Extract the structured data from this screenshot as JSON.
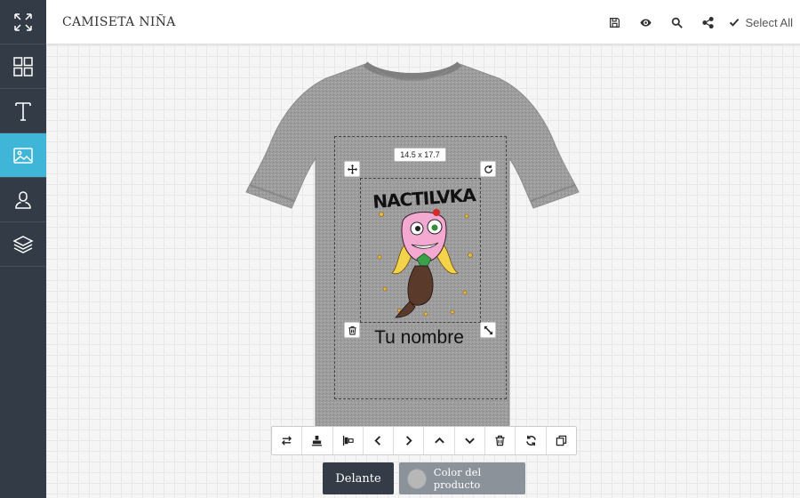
{
  "header": {
    "title": "CAMISETA NIÑA",
    "select_all_label": "Select All",
    "tools": [
      "save-icon",
      "eye-icon",
      "search-icon",
      "share-icon"
    ]
  },
  "sidebar": {
    "items": [
      {
        "icon": "fullscreen-icon"
      },
      {
        "icon": "grid-icon"
      },
      {
        "icon": "text-icon"
      },
      {
        "icon": "image-icon",
        "active": true
      },
      {
        "icon": "user-icon"
      },
      {
        "icon": "layers-icon"
      }
    ],
    "active_color": "#3fb5d8",
    "background": "#333b47"
  },
  "canvas": {
    "product_color": "#9b9b9b",
    "selection_size": "14.5 x 17.7",
    "artwork_title": "NACTILVKA",
    "name_text": "Tu nombre"
  },
  "bottom_toolbar": {
    "buttons": [
      "swap-icon",
      "align-bottom-icon",
      "align-left-icon",
      "arrow-left-icon",
      "arrow-right-icon",
      "arrow-up-icon",
      "arrow-down-icon",
      "trash-icon",
      "refresh-icon",
      "duplicate-icon"
    ]
  },
  "views": {
    "front_label": "Delante",
    "color_label": "Color del producto"
  }
}
